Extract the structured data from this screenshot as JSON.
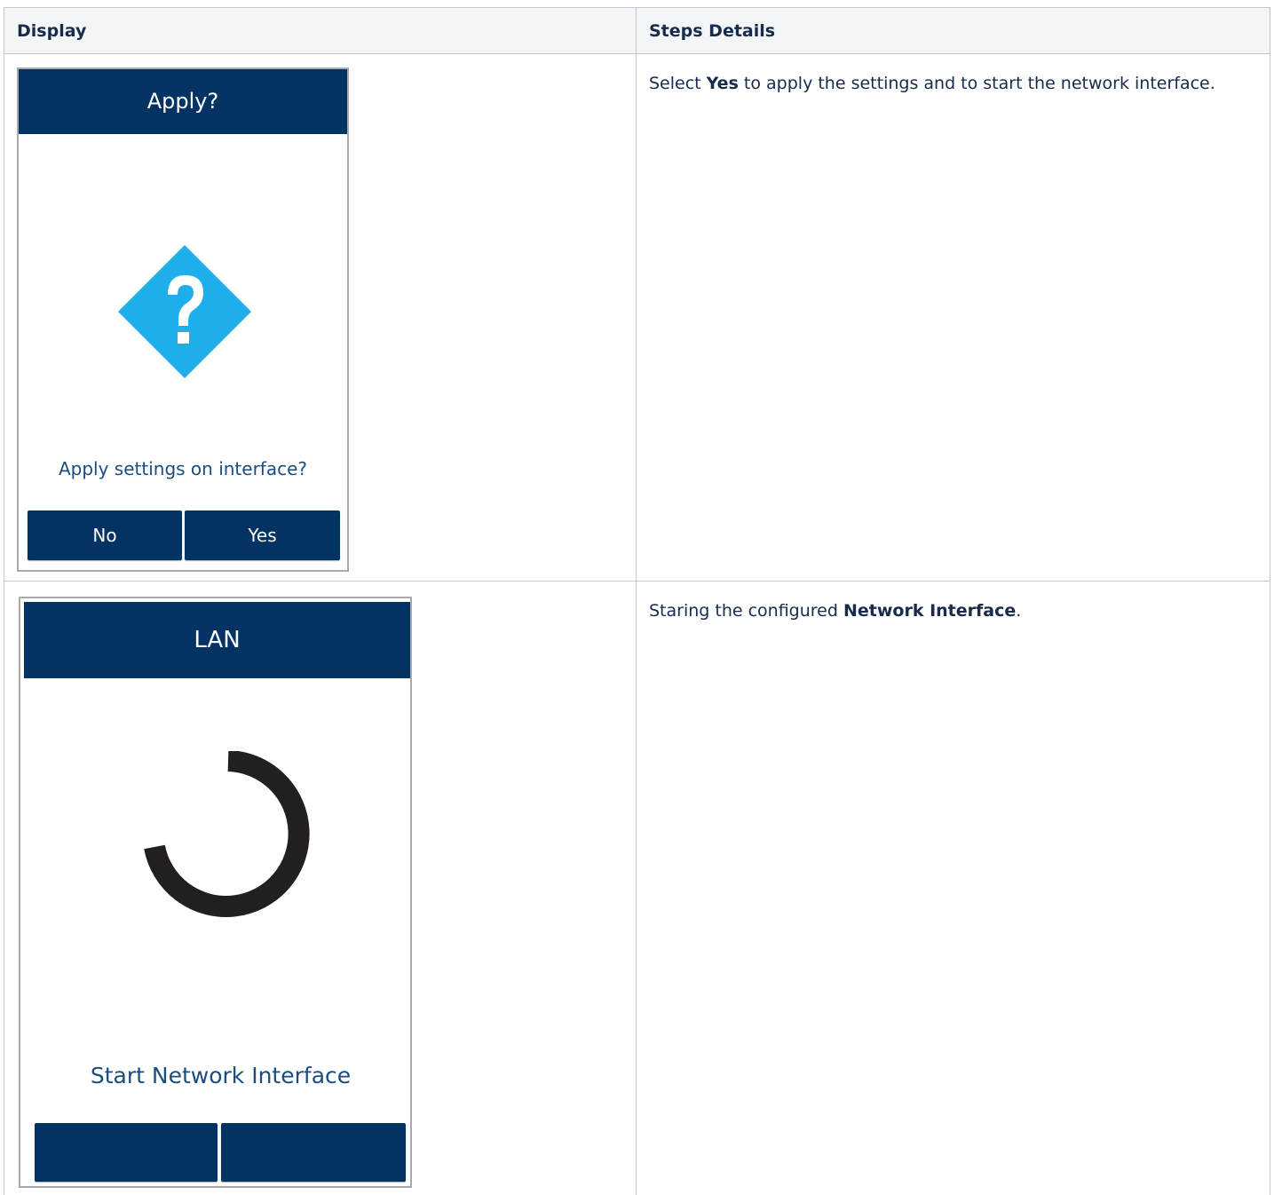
{
  "table": {
    "headers": [
      "Display",
      "Steps Details"
    ]
  },
  "rows": [
    {
      "device": {
        "header": "Apply?",
        "icon": "question-diamond-icon",
        "message": "Apply settings on interface?",
        "buttons": [
          "No",
          "Yes"
        ]
      },
      "details": {
        "pre": "Select ",
        "bold": "Yes",
        "post": " to apply the settings and to start the network interface."
      }
    },
    {
      "device": {
        "header": "LAN",
        "icon": "loading-spinner-icon",
        "message": "Start Network Interface",
        "buttons": [
          "",
          ""
        ]
      },
      "details": {
        "pre": "Staring the configured ",
        "bold": "Network Interface",
        "post": "."
      }
    }
  ],
  "colors": {
    "device_header": "#033363",
    "device_text": "#1a4d80",
    "question_icon": "#1eaee9",
    "spinner": "#231f20",
    "table_header_bg": "#f4f5f7",
    "table_border": "#c1c7d0"
  }
}
